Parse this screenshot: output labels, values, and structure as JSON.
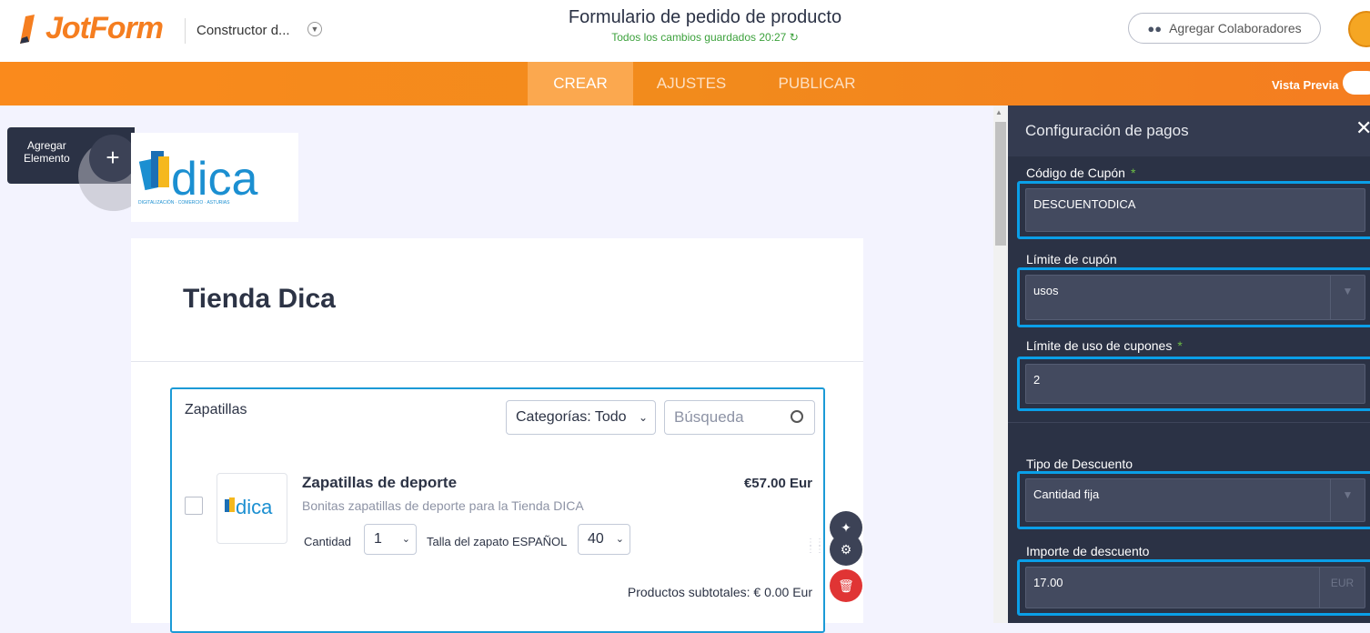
{
  "header": {
    "brand": "JotForm",
    "builder_name": "Constructor d...",
    "form_title": "Formulario de pedido de producto",
    "save_status": "Todos los cambios guardados 20:27",
    "collab_button": "Agregar Colaboradores"
  },
  "tabs": [
    {
      "label": "CREAR",
      "active": true
    },
    {
      "label": "AJUSTES",
      "active": false
    },
    {
      "label": "PUBLICAR",
      "active": false
    }
  ],
  "preview_label": "Vista Previa",
  "add_element": {
    "line1": "Agregar",
    "line2": "Elemento",
    "plus": "+"
  },
  "form": {
    "heading": "Tienda Dica",
    "product_list": {
      "title": "Zapatillas",
      "category_select": "Categorías: Todo",
      "search_placeholder": "Búsqueda",
      "product": {
        "name": "Zapatillas de deporte",
        "description": "Bonitas zapatillas de deporte para la Tienda DICA",
        "price": "€57.00 Eur",
        "qty_label": "Cantidad",
        "qty_value": "1",
        "size_label": "Talla del zapato ESPAÑOL",
        "size_value": "40"
      },
      "subtotal": "Productos subtotales:  € 0.00 Eur"
    }
  },
  "panel": {
    "title": "Configuración de pagos",
    "fields": [
      {
        "label": "Código de Cupón",
        "required": "*",
        "value": "DESCUENTODICA"
      },
      {
        "label": "Límite de cupón",
        "value": "usos"
      },
      {
        "label": "Límite de uso de cupones",
        "required": "*",
        "value": "2"
      },
      {
        "label": "Tipo de Descuento",
        "value": "Cantidad fija"
      },
      {
        "label": "Importe de descuento",
        "value": "17.00",
        "unit": "EUR"
      }
    ]
  },
  "colors": {
    "accent": "#f57e20",
    "panel": "#2b3245",
    "highlight": "#0a9fe8",
    "required": "#6cbe45"
  },
  "icons": {
    "collab": "users-icon",
    "refresh": "refresh-icon",
    "search": "search-icon",
    "wand": "magic-wand-icon",
    "gear": "gear-icon",
    "trash": "trash-icon",
    "close": "close-icon"
  }
}
